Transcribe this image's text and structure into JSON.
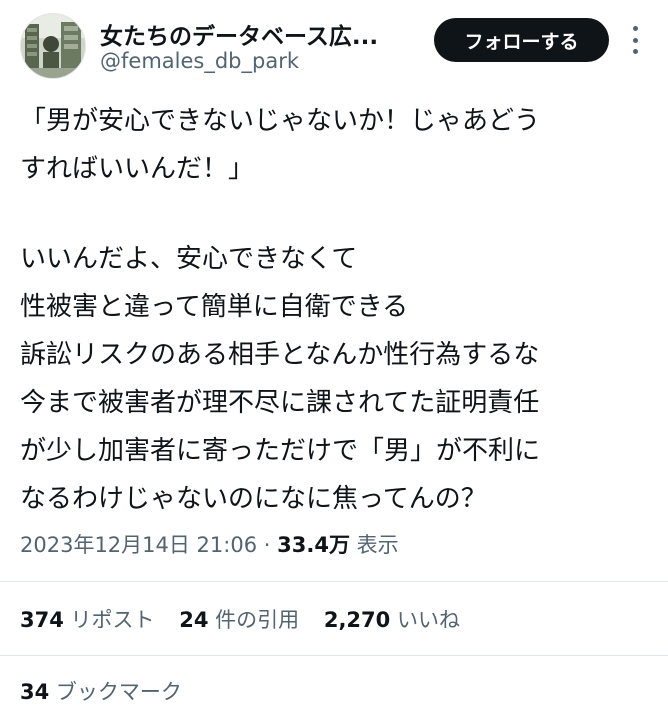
{
  "author": {
    "display_name": "女たちのデータベース広...",
    "handle": "@females_db_park",
    "follow_label": "フォローする"
  },
  "tweet": {
    "lines": [
      "「男が安心できないじゃないか！じゃあどう",
      "すればいいんだ！」",
      "いいんだよ、安心できなくて",
      "性被害と違って簡単に自衛できる",
      "訴訟リスクのある相手となんか性行為するな",
      "今まで被害者が理不尽に課されてた証明責任",
      "が少し加害者に寄っただけで「男」が不利に",
      "なるわけじゃないのになに焦ってんの？"
    ]
  },
  "meta": {
    "timestamp": "2023年12月14日 21:06",
    "separator": "·",
    "views_count": "33.4万",
    "views_label": "表示"
  },
  "stats": {
    "reposts_count": "374",
    "reposts_label": "リポスト",
    "quotes_count": "24",
    "quotes_label": "件の引用",
    "likes_count": "2,270",
    "likes_label": "いいね",
    "bookmarks_count": "34",
    "bookmarks_label": "ブックマーク"
  },
  "colors": {
    "text": "#0f1419",
    "secondary": "#536471",
    "follow_button_bg": "#0f1419",
    "divider": "#e1e6ea"
  },
  "icons": {
    "more": "more-vertical-icon"
  }
}
